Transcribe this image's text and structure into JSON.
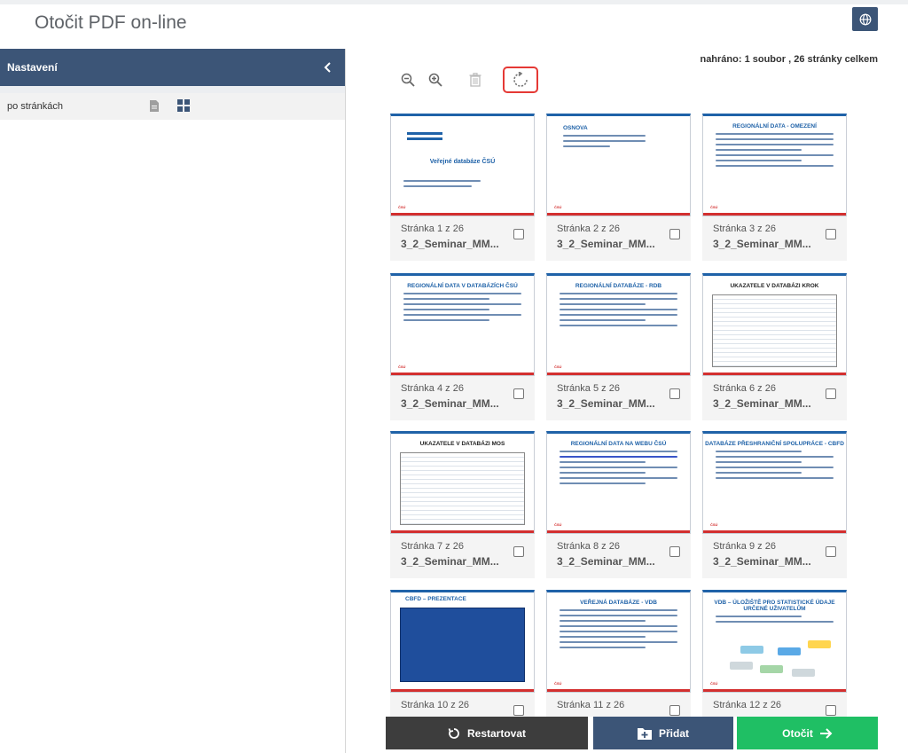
{
  "header": {
    "title": "Otočit PDF on-line",
    "language_icon": "globe-icon"
  },
  "sidebar": {
    "title": "Nastavení",
    "collapse_icon": "chevron-left-icon",
    "mode_label": "po stránkách",
    "mode_icons": [
      "document-icon",
      "grid-icon"
    ]
  },
  "status": "nahráno: 1 soubor , 26 stránky celkem",
  "toolbar": {
    "icons": [
      "zoom-out-icon",
      "zoom-in-icon",
      "trash-icon",
      "rotate-icon"
    ]
  },
  "thumbs": {
    "t1": "Veřejné databáze ČSÚ",
    "t2": "OSNOVA",
    "t3": "REGIONÁLNÍ DATA - OMEZENÍ",
    "t4": "REGIONÁLNÍ DATA V DATABÁZÍCH ČSÚ",
    "t5": "REGIONÁLNÍ DATABÁZE - RDB",
    "t6": "UKAZATELE V DATABÁZI KROK",
    "t7": "UKAZATELE V DATABÁZI MOS",
    "t8": "REGIONÁLNÍ DATA NA WEBU ČSÚ",
    "t9": "DATABÁZE PŘESHRANIČNÍ SPOLUPRÁCE - CBFD",
    "t10": "CBFD – PREZENTACE",
    "t11": "VEŘEJNÁ DATABÁZE - VDB",
    "t12": "VDB – ÚLOŽIŠTĚ PRO STATISTICKÉ ÚDAJE URČENÉ UŽIVATELŮM",
    "footer": "ČSÚ"
  },
  "pages": [
    {
      "label": "Stránka 1 z 26",
      "name": "3_2_Seminar_MM..."
    },
    {
      "label": "Stránka 2 z 26",
      "name": "3_2_Seminar_MM..."
    },
    {
      "label": "Stránka 3 z 26",
      "name": "3_2_Seminar_MM..."
    },
    {
      "label": "Stránka 4 z 26",
      "name": "3_2_Seminar_MM..."
    },
    {
      "label": "Stránka 5 z 26",
      "name": "3_2_Seminar_MM..."
    },
    {
      "label": "Stránka 6 z 26",
      "name": "3_2_Seminar_MM..."
    },
    {
      "label": "Stránka 7 z 26",
      "name": "3_2_Seminar_MM..."
    },
    {
      "label": "Stránka 8 z 26",
      "name": "3_2_Seminar_MM..."
    },
    {
      "label": "Stránka 9 z 26",
      "name": "3_2_Seminar_MM..."
    },
    {
      "label": "Stránka 10 z 26",
      "name": ""
    },
    {
      "label": "Stránka 11 z 26",
      "name": ""
    },
    {
      "label": "Stránka 12 z 26",
      "name": ""
    }
  ],
  "buttons": {
    "restart": "Restartovat",
    "add": "Přidat",
    "rotate": "Otočit"
  },
  "colors": {
    "header": "#3c5577",
    "accent_green": "#1fbf64",
    "dark": "#3d3d3d",
    "highlight": "#e53935"
  }
}
